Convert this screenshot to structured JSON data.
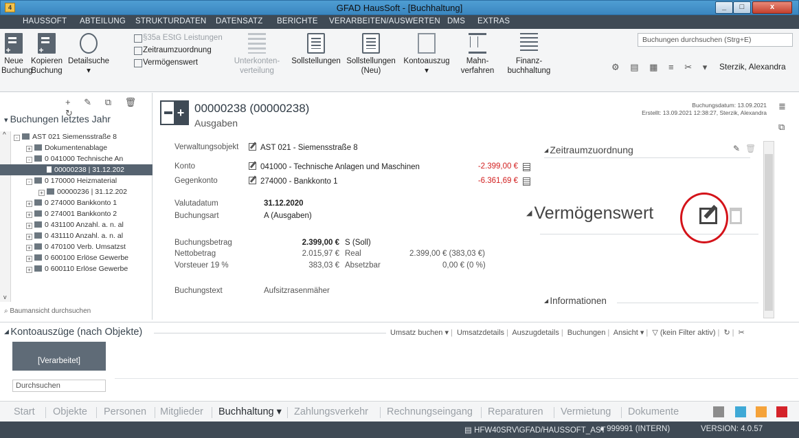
{
  "window": {
    "title": "GFAD HausSoft - [Buchhaltung]",
    "min": "_",
    "max": "□",
    "close": "x"
  },
  "menu": [
    "HAUSSOFT",
    "ABTEILUNG",
    "STRUKTURDATEN",
    "DATENSATZ",
    "BERICHTE",
    "VERARBEITEN/AUSWERTEN",
    "DMS",
    "EXTRAS"
  ],
  "ribbon": {
    "neue_buchung": "Neue Buchung",
    "kopieren_buchung": "Kopieren Buchung",
    "detailsuche": "Detailsuche",
    "small_items": [
      "§35a EStG Leistungen",
      "Zeitraumzuordnung",
      "Vermögenswert"
    ],
    "unterkonten": "Unterkonten-verteilung",
    "sollstellungen": "Sollstellungen",
    "sollstellungen_neu": "Sollstellungen (Neu)",
    "kontoauszug": "Kontoauszug",
    "mahnverfahren": "Mahn-verfahren",
    "finanzbuchhaltung": "Finanz-buchhaltung",
    "search_placeholder": "Buchungen durchsuchen (Strg+E)",
    "user": "Sterzik, Alexandra"
  },
  "tree": {
    "title": "Buchungen letztes Jahr",
    "filter": "Baumansicht durchsuchen",
    "nodes": [
      {
        "label": "AST 021   Siemensstraße 8",
        "indent": 0,
        "exp": "-"
      },
      {
        "label": "Dokumentenablage",
        "indent": 1,
        "exp": "+"
      },
      {
        "label": "0 041000 Technische An",
        "indent": 1,
        "exp": "-"
      },
      {
        "label": "00000238 | 31.12.202",
        "indent": 2,
        "exp": "",
        "selected": true
      },
      {
        "label": "0 170000 Heizmaterial",
        "indent": 1,
        "exp": "-"
      },
      {
        "label": "00000236 | 31.12.202",
        "indent": 2,
        "exp": "+"
      },
      {
        "label": "0 274000 Bankkonto 1",
        "indent": 1,
        "exp": "+"
      },
      {
        "label": "0 274001 Bankkonto 2",
        "indent": 1,
        "exp": "+"
      },
      {
        "label": "0 431100 Anzahl. a. n. al",
        "indent": 1,
        "exp": "+"
      },
      {
        "label": "0 431110 Anzahl. a. n. al",
        "indent": 1,
        "exp": "+"
      },
      {
        "label": "0 470100 Verb. Umsatzst",
        "indent": 1,
        "exp": "+"
      },
      {
        "label": "0 600100 Erlöse Gewerbe",
        "indent": 1,
        "exp": "+"
      },
      {
        "label": "0 600110 Erlöse Gewerbe",
        "indent": 1,
        "exp": "+"
      }
    ]
  },
  "doc": {
    "number": "00000238 (00000238)",
    "type": "Ausgaben",
    "buchungsdatum": "Buchungsdatum: 13.09.2021",
    "erstellt": "Erstellt: 13.09.2021 12:38:27, Sterzik, Alexandra",
    "fields": {
      "verwaltungsobjekt_label": "Verwaltungsobjekt",
      "verwaltungsobjekt": "AST 021 - Siemensstraße 8",
      "konto_label": "Konto",
      "konto": "041000 - Technische Anlagen und Maschinen",
      "konto_amount": "-2.399,00 €",
      "gegenkonto_label": "Gegenkonto",
      "gegenkonto": "274000 - Bankkonto 1",
      "gegenkonto_amount": "-6.361,69 €",
      "valutadatum_label": "Valutadatum",
      "valutadatum": "31.12.2020",
      "buchungsart_label": "Buchungsart",
      "buchungsart": "A (Ausgaben)",
      "buchungsbetrag_label": "Buchungsbetrag",
      "buchungsbetrag": "2.399,00 €",
      "soll": "S (Soll)",
      "nettobetrag_label": "Nettobetrag",
      "nettobetrag": "2.015,97 €",
      "real_label": "Real",
      "real": "2.399,00 € (383,03 €)",
      "vorsteuer_label": "Vorsteuer 19 %",
      "vorsteuer": "383,03 €",
      "absetzbar_label": "Absetzbar",
      "absetzbar": "0,00 € (0 %)",
      "buchungstext_label": "Buchungstext",
      "buchungstext": "Aufsitzrasenmäher"
    }
  },
  "sections": {
    "zeitraum": "Zeitraumzuordnung",
    "vermoegen": "Vermögenswert",
    "informationen": "Informationen"
  },
  "konto": {
    "title": "Kontoauszüge (nach Objekte)",
    "actions": [
      "Umsatz buchen ▾",
      "Umsatzdetails",
      "Auszugdetails",
      "Buchungen",
      "Ansicht ▾",
      "(kein Filter aktiv)"
    ],
    "tile": "[Verarbeitet]",
    "search": "Durchsuchen"
  },
  "nav": {
    "tabs": [
      "Start",
      "Objekte",
      "Personen",
      "Mitglieder",
      "Buchhaltung ▾",
      "Zahlungsverkehr",
      "Rechnungseingang",
      "Reparaturen",
      "Vermietung",
      "Dokumente"
    ],
    "active": "Buchhaltung ▾",
    "swatches": [
      "#8c8c8c",
      "#3fa9d6",
      "#f5a33a",
      "#d4232a"
    ]
  },
  "status": {
    "server": "HFW40SRV\\GFAD/HAUSSOFT_AST",
    "user": "999991 (INTERN)",
    "version": "VERSION: 4.0.57"
  }
}
